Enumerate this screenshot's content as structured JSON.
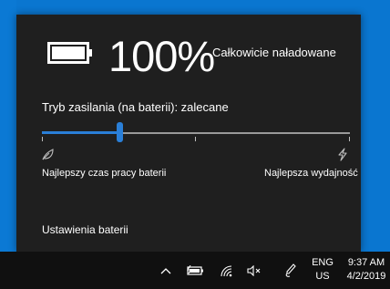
{
  "battery": {
    "percentage": "100%",
    "status": "Całkowicie naładowane",
    "icon": "battery-full-icon"
  },
  "power_mode": {
    "label": "Tryb zasilania (na baterii): zalecane",
    "slider_level": 0.25,
    "left_label": "Najlepszy czas pracy baterii",
    "right_label": "Najlepsza wydajność",
    "left_icon": "leaf-icon",
    "right_icon": "lightning-icon"
  },
  "settings_link": "Ustawienia baterii",
  "taskbar": {
    "icons": [
      "chevron-up-icon",
      "battery-charging-icon",
      "wifi-icon",
      "volume-muted-icon",
      "pen-icon"
    ],
    "language": {
      "line1": "ENG",
      "line2": "US"
    },
    "clock": {
      "time": "9:37 AM",
      "date": "4/2/2019"
    }
  },
  "colors": {
    "accent": "#2a7fd8",
    "flyout_bg": "#1f1f1f",
    "taskbar_bg": "#101010",
    "desktop_bg": "#0a76d0"
  }
}
